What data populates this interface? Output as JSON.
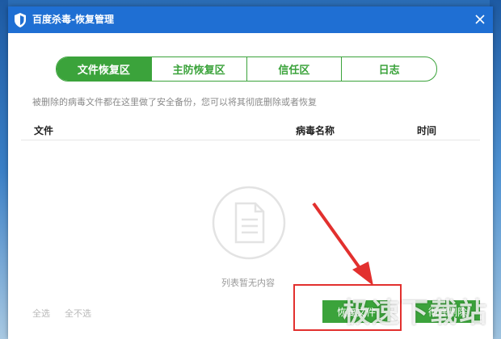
{
  "window": {
    "title": "百度杀毒-恢复管理"
  },
  "tabs": [
    {
      "label": "文件恢复区",
      "active": true
    },
    {
      "label": "主防恢复区",
      "active": false
    },
    {
      "label": "信任区",
      "active": false
    },
    {
      "label": "日志",
      "active": false
    }
  ],
  "description": "被删除的病毒文件都在这里做了安全备份，您可以将其彻底删除或者恢复",
  "table": {
    "columns": [
      "文件",
      "病毒名称",
      "时间"
    ],
    "rows": []
  },
  "empty_state": "列表暂无内容",
  "footer": {
    "select_all": "全选",
    "deselect_all": "全不选",
    "restore_button": "恢复文件",
    "delete_button": "彻底删除"
  },
  "watermark": "极速下载站",
  "colors": {
    "titlebar": "#1f6fd3",
    "accent_green": "#3ba33b",
    "annotation_red": "#e2302e"
  }
}
